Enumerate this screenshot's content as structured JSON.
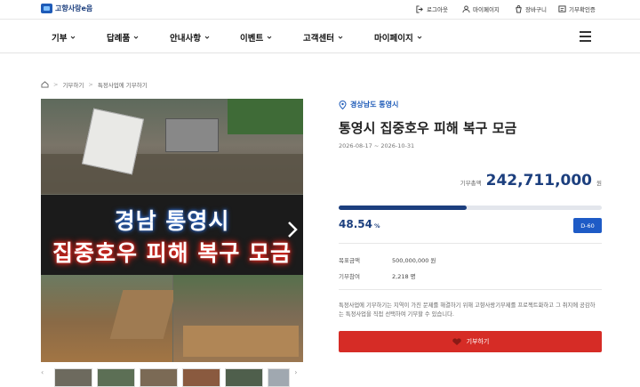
{
  "header": {
    "logo_text": "고향사랑e음",
    "util": [
      {
        "label": "로그아웃",
        "icon": "logout-icon"
      },
      {
        "label": "마이페이지",
        "icon": "user-icon"
      },
      {
        "label": "장바구니",
        "icon": "cart-icon"
      },
      {
        "label": "기부확인증",
        "icon": "certificate-icon"
      }
    ]
  },
  "nav": {
    "items": [
      "기부",
      "답례품",
      "안내사항",
      "이벤트",
      "고객센터",
      "마이페이지"
    ],
    "menu_icon": "hamburger-icon"
  },
  "breadcrumb": [
    "기부하기",
    "특정사업에 기부하기"
  ],
  "hero": {
    "line1": "경남 통영시",
    "line2": "집중호우 피해 복구 모금"
  },
  "project": {
    "location": "경상남도 통영시",
    "title": "통영시 집중호우 피해 복구 모금",
    "period": "2026-08-17 ~ 2026-10-31",
    "amount_label": "기부총액",
    "amount": "242,711,000",
    "amount_unit": "원",
    "progress_percent": 48.54,
    "percent_text": "48.54",
    "percent_unit": "%",
    "dday": "D-60",
    "goal_label": "목표금액",
    "goal_value": "500,000,000 원",
    "participants_label": "기부참여",
    "participants_value": "2,218 명",
    "description": "특정사업에 기부하기는 지역이 가진 문제를 해결하기 위해 고향사랑기부제를 프로젝트화하고 그 취지에 공감하는 특정사업을 직접 선택하여 기부할 수 있습니다.",
    "donate_label": "기부하기"
  },
  "colors": {
    "brand_navy": "#1c3f7e",
    "accent_blue": "#1e5bc6",
    "donate_red": "#d62c26"
  }
}
